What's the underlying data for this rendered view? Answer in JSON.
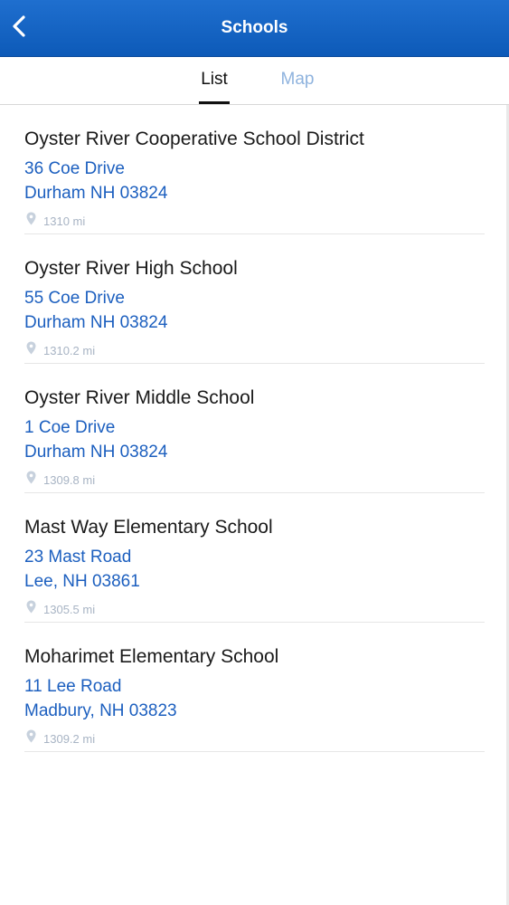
{
  "header": {
    "title": "Schools"
  },
  "tabs": [
    {
      "label": "List"
    },
    {
      "label": "Map"
    }
  ],
  "schools": [
    {
      "name": "Oyster River Cooperative School District",
      "address_line1": "36 Coe Drive",
      "address_line2": "Durham NH 03824",
      "distance": "1310 mi"
    },
    {
      "name": "Oyster River High School",
      "address_line1": "55 Coe Drive",
      "address_line2": "Durham NH 03824",
      "distance": "1310.2 mi"
    },
    {
      "name": "Oyster River Middle School",
      "address_line1": "1 Coe Drive",
      "address_line2": "Durham NH 03824",
      "distance": "1309.8 mi"
    },
    {
      "name": "Mast Way Elementary School",
      "address_line1": "23 Mast Road",
      "address_line2": "Lee, NH 03861",
      "distance": "1305.5 mi"
    },
    {
      "name": "Moharimet Elementary School",
      "address_line1": "11 Lee Road",
      "address_line2": "Madbury, NH 03823",
      "distance": "1309.2 mi"
    }
  ],
  "colors": {
    "header_blue": "#1464c4",
    "link_blue": "#1c5fbf",
    "inactive_tab": "#8fb3de",
    "distance_gray": "#a8b4c4"
  },
  "icons": {
    "back": "chevron-left-icon",
    "distance": "location-pin-icon"
  }
}
